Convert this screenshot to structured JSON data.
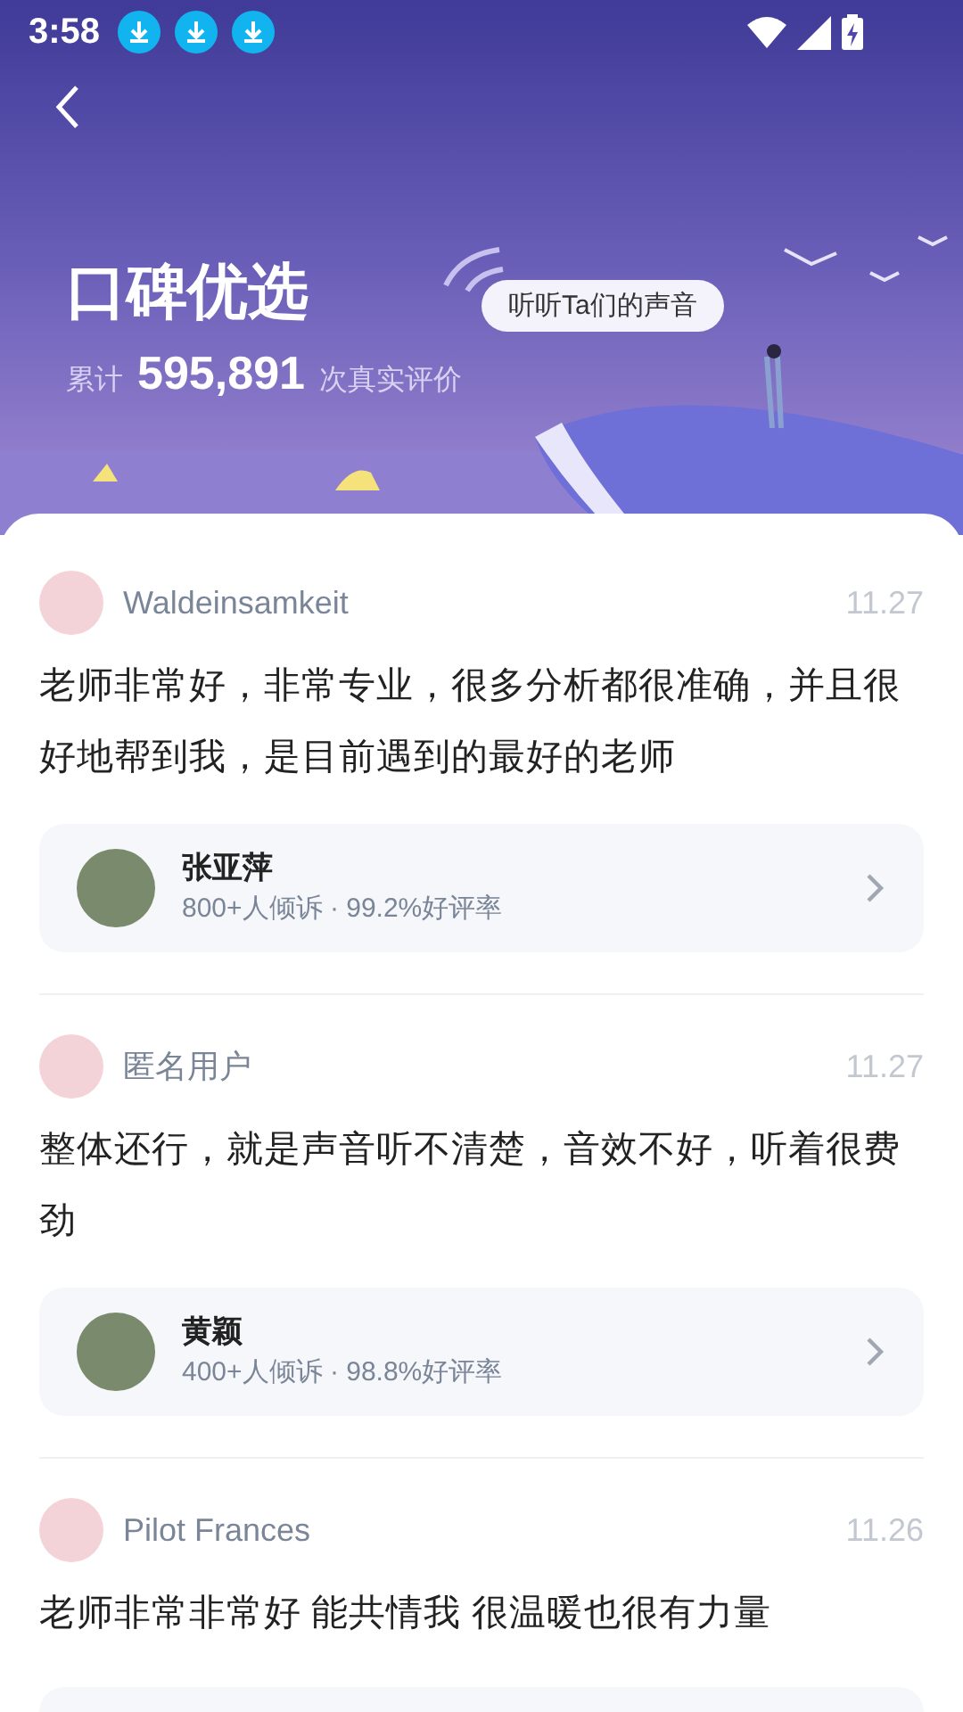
{
  "status_bar": {
    "time": "3:58"
  },
  "banner": {
    "title": "口碑优选",
    "count_prefix": "累计",
    "count": "595,891",
    "count_suffix": "次真实评价",
    "bubble": "听听Ta们的声音"
  },
  "reviews": [
    {
      "user": "Waldeinsamkeit",
      "date": "11.27",
      "text": "老师非常好，非常专业，很多分析都很准确，并且很好地帮到我，是目前遇到的最好的老师",
      "counselor": {
        "name": "张亚萍",
        "stats": "800+人倾诉 · 99.2%好评率"
      }
    },
    {
      "user": "匿名用户",
      "date": "11.27",
      "text": "整体还行，就是声音听不清楚，音效不好，听着很费劲",
      "counselor": {
        "name": "黄颖",
        "stats": "400+人倾诉 · 98.8%好评率"
      }
    },
    {
      "user": "Pilot Frances",
      "date": "11.26",
      "text": "老师非常非常好 能共情我 很温暖也很有力量"
    }
  ]
}
